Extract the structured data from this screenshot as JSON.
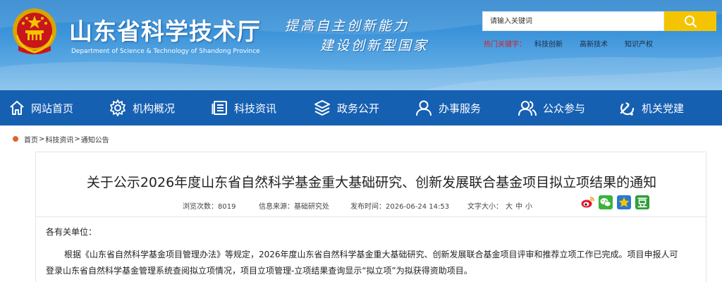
{
  "header": {
    "title": "山东省科学技术厅",
    "subtitle": "Department of Science & Technology of Shandong Province",
    "slogan_line1": "提高自主创新能力",
    "slogan_line2": "建设创新型国家",
    "search": {
      "placeholder": "请输入关键词"
    },
    "hotwords": {
      "label": "热门关键字：",
      "items": [
        "科技创新",
        "高新技术",
        "知识产权"
      ]
    }
  },
  "nav": {
    "items": [
      {
        "label": "网站首页",
        "icon": "home-icon"
      },
      {
        "label": "机构概况",
        "icon": "gear-icon"
      },
      {
        "label": "科技资讯",
        "icon": "news-icon"
      },
      {
        "label": "政务公开",
        "icon": "layers-icon"
      },
      {
        "label": "办事服务",
        "icon": "user-icon"
      },
      {
        "label": "公众参与",
        "icon": "users-icon"
      },
      {
        "label": "机关党建",
        "icon": "party-icon"
      }
    ]
  },
  "breadcrumb": [
    "首页",
    "科技资讯",
    "通知公告"
  ],
  "article": {
    "title": "关于公示2026年度山东省自然科学基金重大基础研究、创新发展联合基金项目拟立项结果的通知",
    "meta": {
      "views_label": "浏览次数：",
      "views": "8019",
      "source_label": "信息来源：",
      "source": "基础研究处",
      "date_label": "发布时间：",
      "date": "2026-06-24 14:53",
      "size_label": "文字大小：",
      "size_large": "大",
      "size_medium": "中",
      "size_small": "小"
    },
    "share_icons": [
      "weibo-icon",
      "wechat-icon",
      "qzone-icon",
      "douban-icon"
    ],
    "greeting": "各有关单位：",
    "paragraph": "根据《山东省自然科学基金项目管理办法》等规定，2026年度山东省自然科学基金重大基础研究、创新发展联合基金项目评审和推荐立项工作已完成。项目申报人可登录山东省自然科学基金管理系统查阅拟立项情况，项目立项管理-立项结果查询显示“拟立项”为拟获得资助项目。"
  },
  "colors": {
    "nav_bg": "#1660b2",
    "search_button": "#f5c400",
    "hotword_label": "#d4202a",
    "breadcrumb_dot": "#e0642a"
  }
}
